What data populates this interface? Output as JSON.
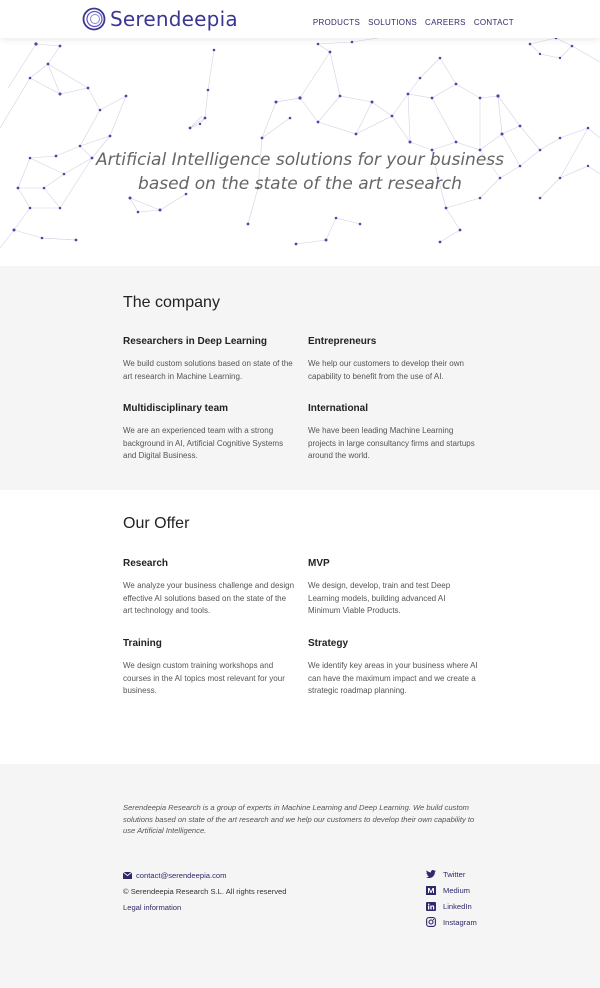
{
  "brand": {
    "name": "Serendeepia",
    "color": "#3a3694"
  },
  "nav": {
    "items": [
      "PRODUCTS",
      "SOLUTIONS",
      "CAREERS",
      "CONTACT"
    ]
  },
  "hero": {
    "line1": "Artificial Intelligence solutions for your business",
    "line2": "based on the state of the art research"
  },
  "company": {
    "title": "The company",
    "items": [
      {
        "heading": "Researchers in Deep Learning",
        "text": "We build custom solutions based on state of the art research in Machine Learning."
      },
      {
        "heading": "Entrepreneurs",
        "text": "We help our customers to develop their own capability to benefit from the use of AI."
      },
      {
        "heading": "Multidisciplinary team",
        "text": "We are an experienced team with a strong background in AI, Artificial Cognitive Systems and Digital Business."
      },
      {
        "heading": "International",
        "text": "We have been leading Machine Learning projects in large consultancy firms and startups around the world."
      }
    ]
  },
  "offer": {
    "title": "Our Offer",
    "items": [
      {
        "heading": "Research",
        "text": "We analyze your business challenge and design effective AI solutions based on the state of the art technology and tools."
      },
      {
        "heading": "MVP",
        "text": "We design, develop, train and test Deep Learning models, building advanced AI Minimum Viable Products."
      },
      {
        "heading": "Training",
        "text": "We design custom training workshops and courses in the AI topics most relevant for your business."
      },
      {
        "heading": "Strategy",
        "text": "We identify key areas in your business where AI can have the maximum impact and we create a strategic roadmap planning."
      }
    ]
  },
  "footer": {
    "about": "Serendeepia Research is a group of experts in Machine Learning and Deep Learning. We build custom solutions based on state of the art research and we help our customers to develop their own capability to use Artificial Intelligence.",
    "email": "contact@serendeepia.com",
    "copyright": "© Serendeepia Research S.L. All rights reserved",
    "legal": "Legal information",
    "socials": [
      {
        "label": "Twitter",
        "icon": "twitter-icon"
      },
      {
        "label": "Medium",
        "icon": "medium-icon"
      },
      {
        "label": "LinkedIn",
        "icon": "linkedin-icon"
      },
      {
        "label": "Instagram",
        "icon": "instagram-icon"
      }
    ]
  }
}
